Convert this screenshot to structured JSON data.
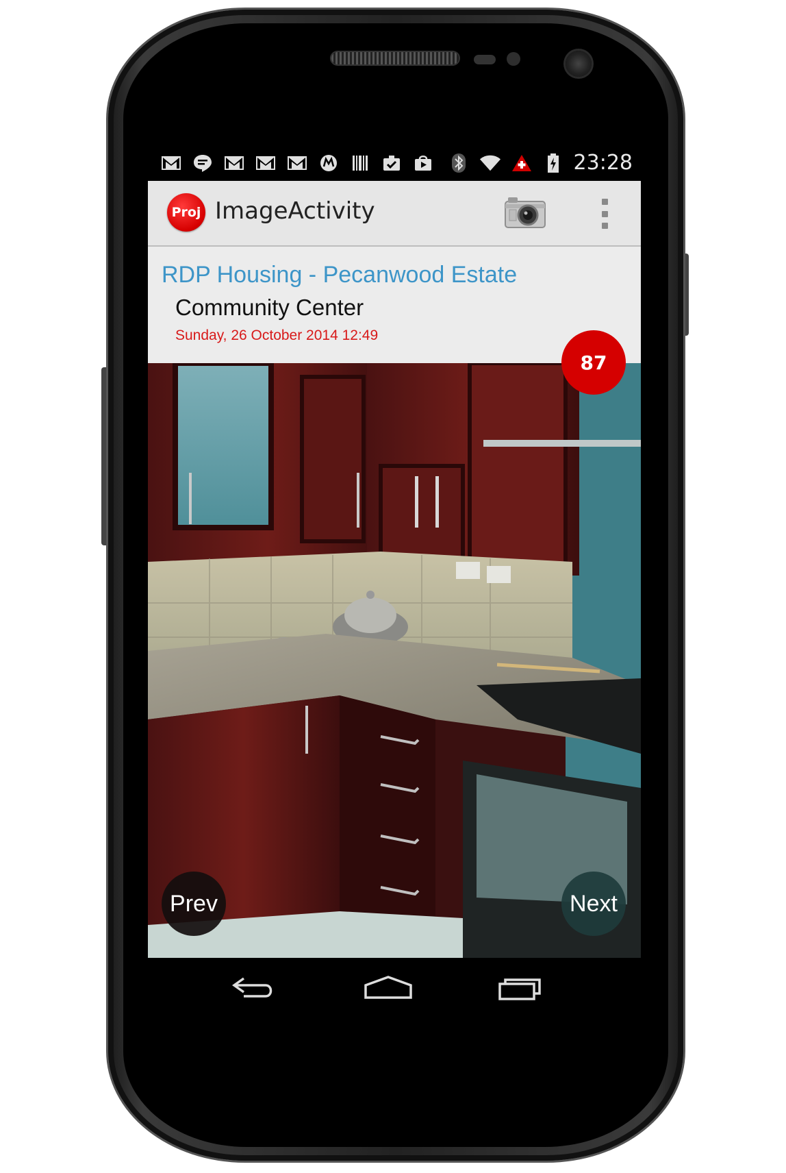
{
  "status_bar": {
    "time": "23:28",
    "icons": [
      "gmail-icon",
      "hangouts-icon",
      "gmail-icon",
      "gmail-icon",
      "gmail-icon",
      "motorola-icon",
      "barcode-icon",
      "clipboard-icon",
      "play-store-icon"
    ],
    "right_icons": [
      "bluetooth-icon",
      "wifi-icon",
      "alert-icon",
      "battery-charging-icon"
    ]
  },
  "action_bar": {
    "logo_text": "Proj",
    "title": "ImageActivity"
  },
  "header": {
    "project_name": "RDP Housing - Pecanwood Estate",
    "site_name": "Community Center",
    "date": "Sunday, 26 October 2014 12:49"
  },
  "photo": {
    "count_badge": "87",
    "prev_label": "Prev",
    "next_label": "Next"
  },
  "colors": {
    "accent_blue": "#3d95c8",
    "date_red": "#d81a1a",
    "badge_red": "#d50000",
    "action_bar_bg": "#e6e6e6"
  }
}
